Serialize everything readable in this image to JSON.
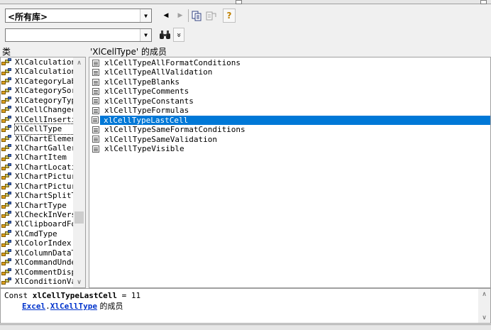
{
  "toolbar": {
    "library_value": "<所有库>",
    "search_value": ""
  },
  "classes": {
    "header": "类",
    "items": [
      "XlCalculation",
      "XlCalculation",
      "XlCategoryLab",
      "XlCategorySor",
      "XlCategoryTyp",
      "XlCellChangec",
      "XlCellInserti",
      "XlCellType",
      "XlChartElemen",
      "XlChartGaller",
      "XlChartItem",
      "XlChartLocati",
      "XlChartPictur",
      "XlChartPictur",
      "XlChartSplitT",
      "XlChartType",
      "XlCheckInVers",
      "XlClipboardFo",
      "XlCmdType",
      "XlColorIndex",
      "XlColumnDataT",
      "XlCommandUnde",
      "XlCommentDisp",
      "XlConditionVa"
    ],
    "selected_index": 7
  },
  "members": {
    "header": "'XlCellType' 的成员",
    "items": [
      "xlCellTypeAllFormatConditions",
      "xlCellTypeAllValidation",
      "xlCellTypeBlanks",
      "xlCellTypeComments",
      "xlCellTypeConstants",
      "xlCellTypeFormulas",
      "xlCellTypeLastCell",
      "xlCellTypeSameFormatConditions",
      "xlCellTypeSameValidation",
      "xlCellTypeVisible"
    ],
    "selected_index": 6
  },
  "detail": {
    "prefix": "Const ",
    "name": "xlCellTypeLastCell",
    "suffix": " = 11",
    "library_link": "Excel",
    "dot": ".",
    "class_link": "XlCellType",
    "member_of": " 的成员"
  },
  "icons": {
    "back": "◀",
    "forward": "▶",
    "copy": "copy-icon",
    "view_definition": "view-definition-icon",
    "help": "?",
    "search": "binoculars-icon",
    "toggle_results": "»"
  },
  "colors": {
    "selection": "#0078d7",
    "link": "#0033cc"
  }
}
